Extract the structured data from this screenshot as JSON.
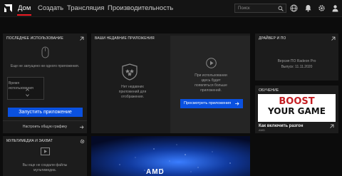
{
  "nav": {
    "items": [
      "Дом",
      "Создать",
      "Трансляция",
      "Производительность"
    ],
    "search_placeholder": "Поиск"
  },
  "recent_usage": {
    "title": "Последнее использование",
    "empty_text": "Еще не запущено ни одного приложения.",
    "time_label": "Время использования",
    "launch_button": "Запустить приложение",
    "settings_link": "Настроить общую графику"
  },
  "recent_apps": {
    "title": "Ваши недавние приложения",
    "no_apps_text": "Нет недавних приложений для отображения.",
    "more_text": "При использовании здесь будет появляться больше приложений.",
    "view_button": "Просмотреть приложения"
  },
  "driver": {
    "title": "Драйвер и ПО",
    "version": "Версия ПО Radeon Pro",
    "release": "Выпуск: 11.11.2020"
  },
  "training": {
    "title": "Обучение",
    "promo_line1": "BOOST",
    "promo_line2": "YOUR GAME",
    "caption": "Как включить разгон",
    "brand": "AMD"
  },
  "media": {
    "title": "Мультимедиа и захват",
    "empty_text": "Вы еще не создали файлы мультимедиа."
  },
  "hero": {
    "brand": "AMD"
  },
  "colors": {
    "accent_red": "#ed1c24",
    "button_blue": "#0a51e0"
  }
}
